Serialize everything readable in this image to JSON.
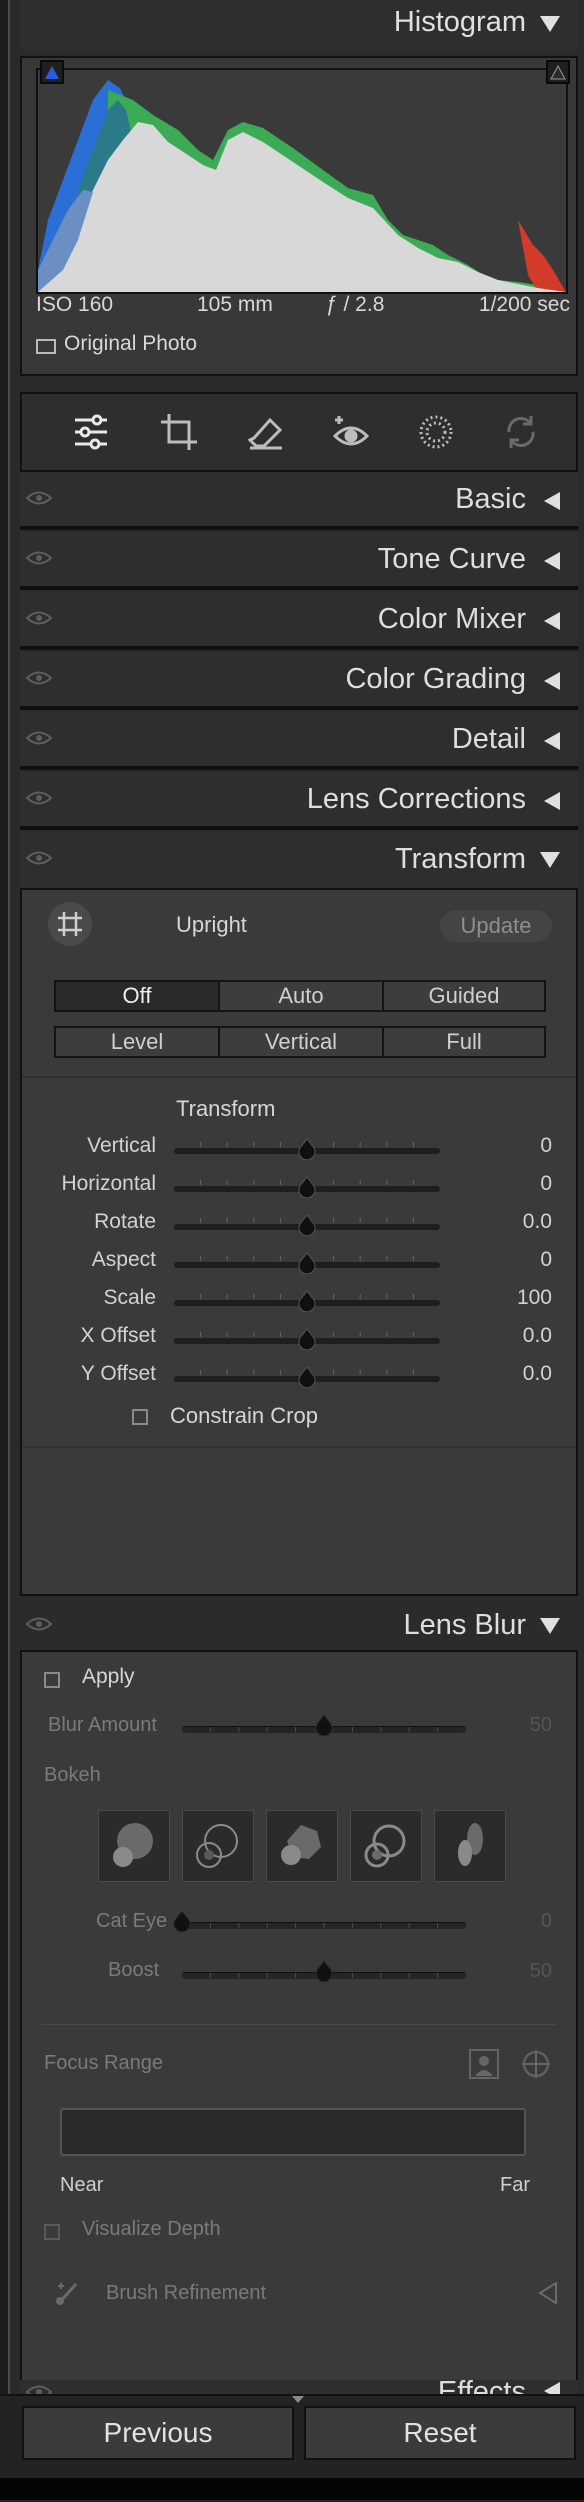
{
  "histogram": {
    "title": "Histogram",
    "iso": "ISO 160",
    "focal": "105 mm",
    "aperture": "ƒ / 2.8",
    "shutter": "1/200 sec",
    "original_photo_label": "Original Photo"
  },
  "toolbar": {
    "icons": [
      "edit-sliders-icon",
      "crop-icon",
      "healing-eraser-icon",
      "red-eye-icon",
      "masking-icon",
      "remix-icon"
    ]
  },
  "panels": {
    "basic": "Basic",
    "tone_curve": "Tone Curve",
    "color_mixer": "Color Mixer",
    "color_grading": "Color Grading",
    "detail": "Detail",
    "lens_corrections": "Lens Corrections",
    "transform": "Transform",
    "lens_blur": "Lens Blur",
    "effects": "Effects"
  },
  "transform": {
    "upright_label": "Upright",
    "update_label": "Update",
    "modes_row1": [
      "Off",
      "Auto",
      "Guided"
    ],
    "modes_row2": [
      "Level",
      "Vertical",
      "Full"
    ],
    "active_mode": "Off",
    "section_title": "Transform",
    "sliders": [
      {
        "label": "Vertical",
        "value": "0",
        "position": 0.5
      },
      {
        "label": "Horizontal",
        "value": "0",
        "position": 0.5
      },
      {
        "label": "Rotate",
        "value": "0.0",
        "position": 0.5
      },
      {
        "label": "Aspect",
        "value": "0",
        "position": 0.5
      },
      {
        "label": "Scale",
        "value": "100",
        "position": 0.5
      },
      {
        "label": "X Offset",
        "value": "0.0",
        "position": 0.5
      },
      {
        "label": "Y Offset",
        "value": "0.0",
        "position": 0.5
      }
    ],
    "constrain_crop": "Constrain Crop"
  },
  "lens_blur": {
    "apply": "Apply",
    "blur_amount_label": "Blur Amount",
    "blur_amount_value": "50",
    "blur_amount_position": 0.5,
    "bokeh_label": "Bokeh",
    "cat_eye_label": "Cat Eye",
    "cat_eye_value": "0",
    "cat_eye_position": 0.0,
    "boost_label": "Boost",
    "boost_value": "50",
    "boost_position": 0.5,
    "focus_range_label": "Focus Range",
    "near": "Near",
    "far": "Far",
    "visualize_depth": "Visualize Depth",
    "brush_refinement": "Brush Refinement"
  },
  "footer": {
    "previous": "Previous",
    "reset": "Reset"
  }
}
